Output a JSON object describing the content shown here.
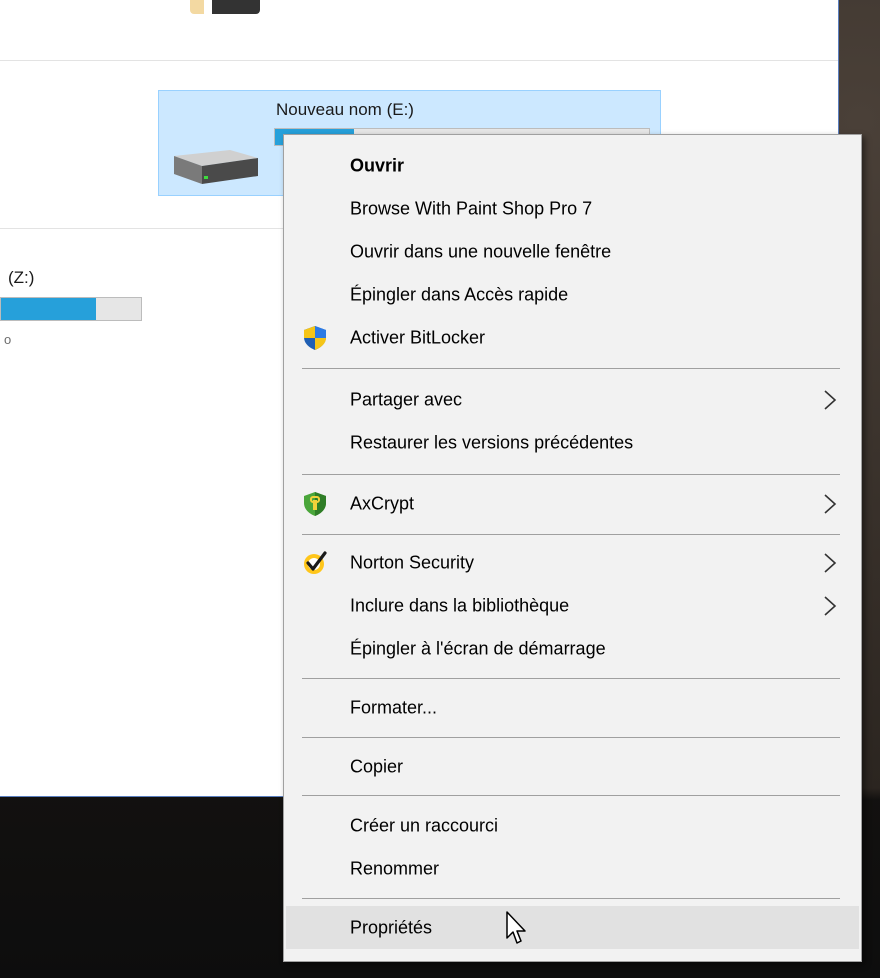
{
  "explorer": {
    "drive_e": {
      "name": "Nouveau nom (E:)",
      "used_fraction": 0.21
    },
    "drive_z": {
      "name": "(Z:)",
      "used_fraction": 0.68,
      "sub_text": "o"
    }
  },
  "context_menu": {
    "items": [
      {
        "label": "Ouvrir",
        "bold": true
      },
      {
        "label": "Browse With Paint Shop Pro 7"
      },
      {
        "label": "Ouvrir dans une nouvelle fenêtre"
      },
      {
        "label": "Épingler dans Accès rapide"
      },
      {
        "label": "Activer BitLocker",
        "icon": "shield-icon"
      },
      {
        "label": "Partager avec",
        "submenu": true
      },
      {
        "label": "Restaurer les versions précédentes"
      },
      {
        "label": "AxCrypt",
        "icon": "axcrypt-icon",
        "submenu": true
      },
      {
        "label": "Norton Security",
        "icon": "norton-icon",
        "submenu": true
      },
      {
        "label": "Inclure dans la bibliothèque",
        "submenu": true
      },
      {
        "label": "Épingler à l'écran de démarrage"
      },
      {
        "label": "Formater..."
      },
      {
        "label": "Copier"
      },
      {
        "label": "Créer un raccourci"
      },
      {
        "label": "Renommer"
      },
      {
        "label": "Propriétés",
        "highlighted": true
      }
    ]
  },
  "colors": {
    "selection_bg": "#cce8ff",
    "progress_fill": "#26a0da",
    "menu_bg": "#f2f2f2",
    "menu_highlight": "#e1e1e1"
  }
}
